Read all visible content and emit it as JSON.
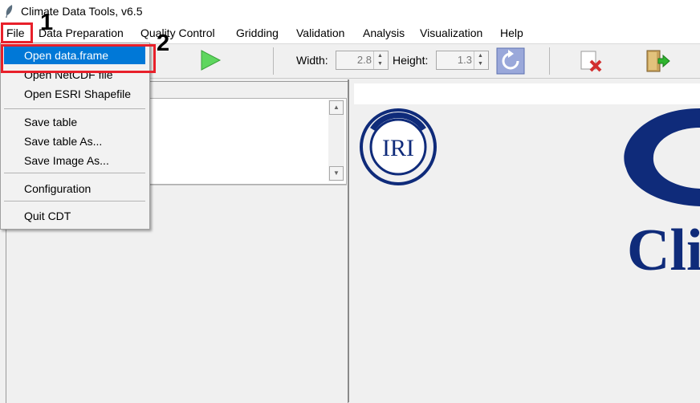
{
  "window": {
    "title": "Climate Data Tools, v6.5",
    "icon": "feather-icon"
  },
  "menubar": {
    "items": [
      "File",
      "Data Preparation",
      "Quality Control",
      "Gridding",
      "Validation",
      "Analysis",
      "Visualization",
      "Help"
    ]
  },
  "toolbar": {
    "run_icon": "play-icon",
    "width_label": "Width:",
    "width_value": "2.8",
    "height_label": "Height:",
    "height_value": "1.3",
    "refresh_icon": "refresh-icon",
    "close_tab_icon": "close-document-icon",
    "exit_icon": "exit-door-icon"
  },
  "file_menu": {
    "items": [
      "Open data.frame",
      "Open NetCDF file",
      "Open ESRI Shapefile",
      "Save table",
      "Save table As...",
      "Save Image As...",
      "Configuration",
      "Quit CDT"
    ],
    "highlighted": "Open data.frame"
  },
  "logo": {
    "text": "IRI",
    "headline": "Cli"
  },
  "annotations": {
    "step1": "1",
    "step2": "2"
  },
  "colors": {
    "highlight": "#0078d7",
    "annotation_box": "#e8202a",
    "logo_blue": "#0f2b7a"
  }
}
